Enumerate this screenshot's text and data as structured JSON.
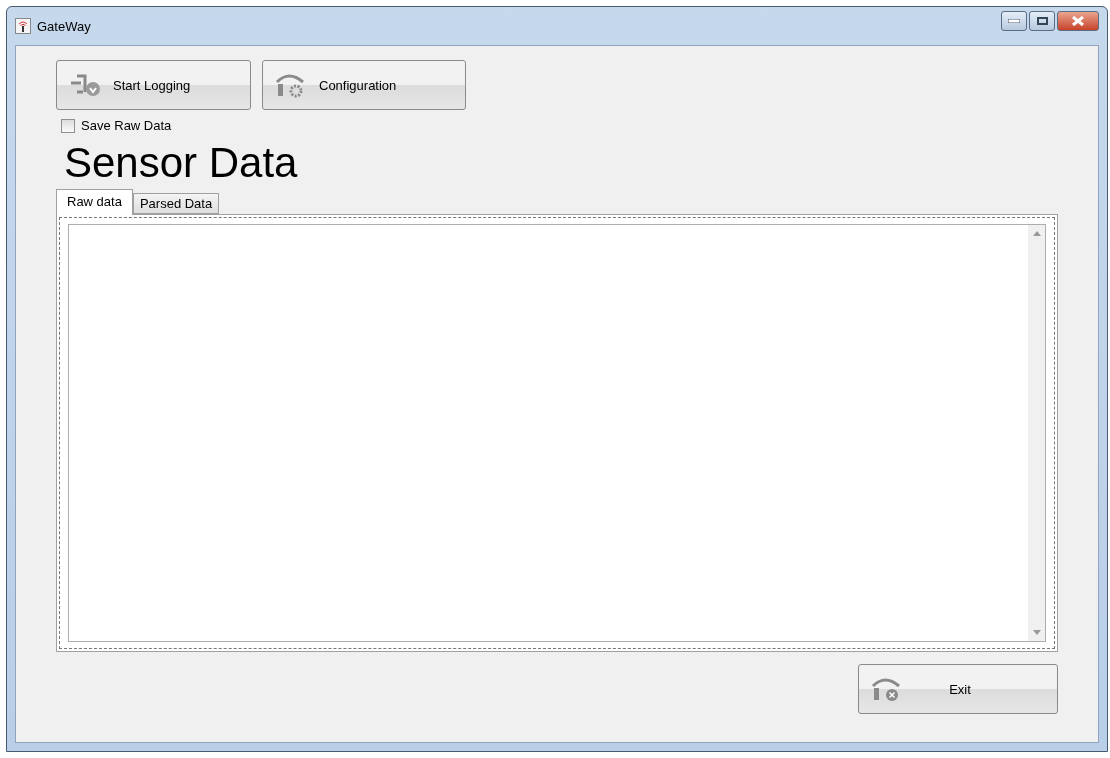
{
  "window": {
    "title": "GateWay"
  },
  "toolbar": [
    {
      "label": "Start Logging",
      "kind": "start"
    },
    {
      "label": "Configuration",
      "kind": "config"
    }
  ],
  "save_raw": {
    "label": "Save Raw Data",
    "checked": false
  },
  "heading": "Sensor Data",
  "tabs": [
    {
      "label": "Raw data",
      "selected": true
    },
    {
      "label": "Parsed Data",
      "selected": false
    }
  ],
  "exit_button": {
    "label": "Exit"
  }
}
